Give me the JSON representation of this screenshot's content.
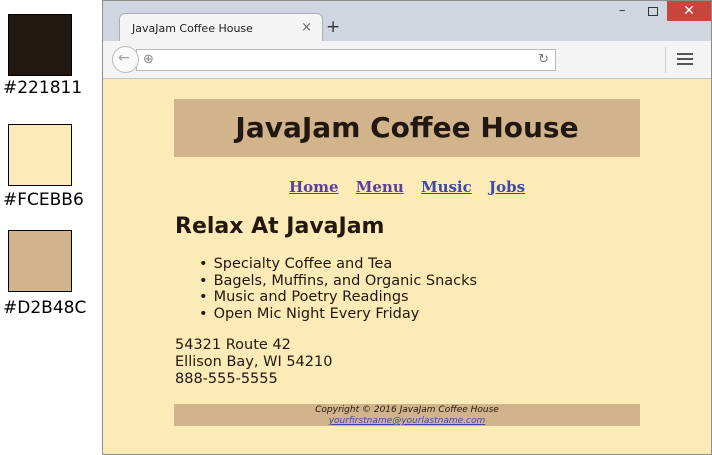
{
  "swatches": [
    {
      "color": "#221811",
      "label": "#221811"
    },
    {
      "color": "#FCEBB6",
      "label": "#FCEBB6"
    },
    {
      "color": "#D2B48C",
      "label": "#D2B48C"
    }
  ],
  "browser": {
    "tab_title": "JavaJam Coffee House",
    "tab_close": "×",
    "new_tab": "+",
    "minimize": "–",
    "close": "✕",
    "back": "←",
    "globe": "⊕",
    "reload": "↻"
  },
  "site": {
    "title": "JavaJam Coffee House",
    "nav": [
      "Home",
      "Menu",
      "Music",
      "Jobs"
    ],
    "heading": "Relax At JavaJam",
    "features": [
      "Specialty Coffee and Tea",
      "Bagels, Muffins, and Organic Snacks",
      "Music and Poetry Readings",
      "Open Mic Night Every Friday"
    ],
    "address": [
      "54321 Route 42",
      "Ellison Bay, WI 54210",
      "888-555-5555"
    ],
    "copyright": "Copyright © 2016 JavaJam Coffee House",
    "email": "yourfirstname@yourlastname.com"
  },
  "colors": {
    "dark": "#221811",
    "background": "#fcebb6",
    "accent": "#d2b48c",
    "link": "#5b3fa0"
  }
}
